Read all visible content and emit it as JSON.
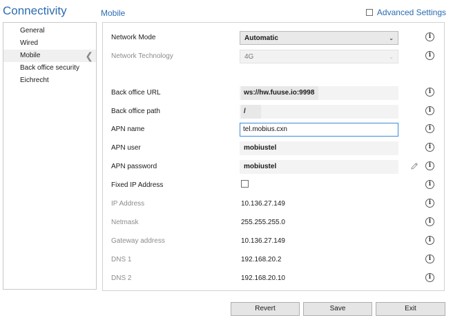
{
  "app_title": "Connectivity",
  "section_title": "Mobile",
  "advanced_settings": {
    "label": "Advanced Settings",
    "checked": false
  },
  "sidebar": {
    "items": [
      {
        "label": "General"
      },
      {
        "label": "Wired"
      },
      {
        "label": "Mobile",
        "active": true
      },
      {
        "label": "Back office security"
      },
      {
        "label": "Eichrecht"
      }
    ]
  },
  "form": {
    "network_mode": {
      "label": "Network Mode",
      "value": "Automatic"
    },
    "network_technology": {
      "label": "Network Technology",
      "value": "4G"
    },
    "back_office_url": {
      "label": "Back office URL",
      "value": "ws://hw.fuuse.io:9998"
    },
    "back_office_path": {
      "label": "Back office path",
      "value": "/"
    },
    "apn_name": {
      "label": "APN name",
      "value": "tel.mobius.cxn"
    },
    "apn_user": {
      "label": "APN user",
      "value": "mobiustel"
    },
    "apn_password": {
      "label": "APN password",
      "value": "mobiustel"
    },
    "fixed_ip": {
      "label": "Fixed IP Address",
      "checked": false
    },
    "ip_address": {
      "label": "IP Address",
      "value": "10.136.27.149"
    },
    "netmask": {
      "label": "Netmask",
      "value": "255.255.255.0"
    },
    "gateway": {
      "label": "Gateway address",
      "value": "10.136.27.149"
    },
    "dns1": {
      "label": "DNS 1",
      "value": "192.168.20.2"
    },
    "dns2": {
      "label": "DNS 2",
      "value": "192.168.20.10"
    }
  },
  "buttons": {
    "revert": "Revert",
    "save": "Save",
    "exit": "Exit"
  },
  "icons": {
    "info": "info-icon",
    "edit": "pencil-icon",
    "chevron": "chevron-left-icon",
    "caret": "chevron-down-icon"
  },
  "colors": {
    "accent": "#2b6cb0",
    "focus_border": "#3c8ad8"
  }
}
